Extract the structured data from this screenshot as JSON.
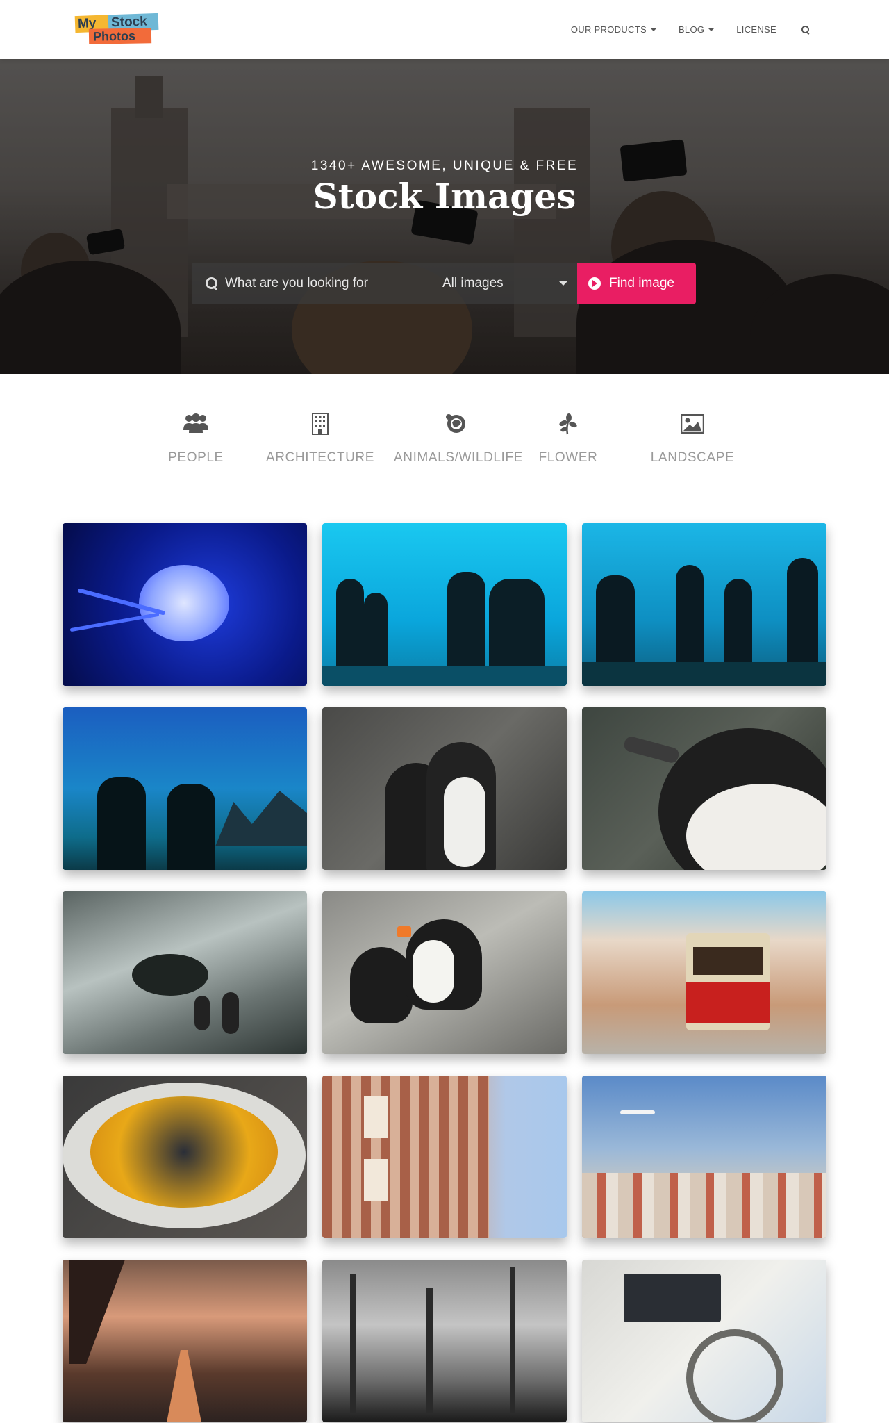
{
  "brand": {
    "logo_text_1": "My",
    "logo_text_2": "Stock",
    "logo_text_3": "Photos"
  },
  "nav": {
    "items": [
      {
        "label": "OUR PRODUCTS",
        "dropdown": true
      },
      {
        "label": "BLOG",
        "dropdown": true
      },
      {
        "label": "LICENSE",
        "dropdown": false
      }
    ],
    "search_icon": "search-icon"
  },
  "hero": {
    "subtitle": "1340+ AWESOME, UNIQUE & FREE",
    "title": "Stock Images",
    "search": {
      "placeholder": "What are you looking for",
      "select_value": "All images",
      "button_label": "Find image"
    }
  },
  "categories": [
    {
      "label": "PEOPLE",
      "icon": "people-icon"
    },
    {
      "label": "ARCHITECTURE",
      "icon": "building-icon"
    },
    {
      "label": "ANIMALS/WILDLIFE",
      "icon": "animal-icon"
    },
    {
      "label": "FLOWER",
      "icon": "flower-icon"
    },
    {
      "label": "LANDSCAPE",
      "icon": "picture-icon"
    }
  ],
  "gallery": [
    {
      "name": "jellyfish"
    },
    {
      "name": "aquarium-visitors"
    },
    {
      "name": "aquarium-silhouettes"
    },
    {
      "name": "aquarium-tank"
    },
    {
      "name": "penguins-pair"
    },
    {
      "name": "penguin-closeup"
    },
    {
      "name": "penguins-rocks"
    },
    {
      "name": "puffins"
    },
    {
      "name": "lisbon-tram"
    },
    {
      "name": "mussels-dish"
    },
    {
      "name": "tiled-building"
    },
    {
      "name": "city-airplane"
    },
    {
      "name": "foggy-road"
    },
    {
      "name": "misty-forest"
    },
    {
      "name": "boat-dashboard"
    }
  ],
  "colors": {
    "accent": "#e91e63",
    "nav_text": "#555555",
    "category_text": "#9a9a9a"
  }
}
